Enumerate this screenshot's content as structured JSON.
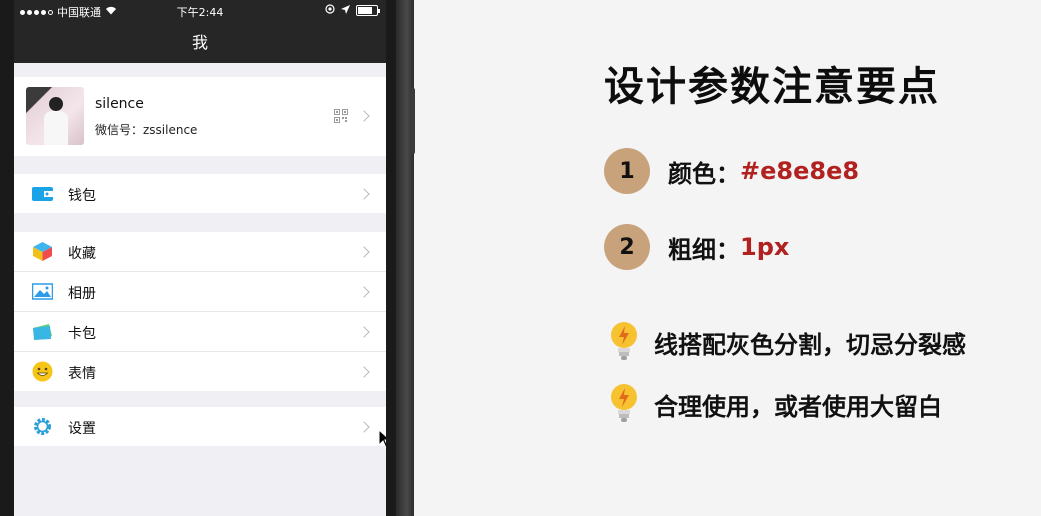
{
  "statusbar": {
    "carrier": "中国联通",
    "time": "下午2:44"
  },
  "navbar": {
    "title": "我"
  },
  "profile": {
    "name": "silence",
    "wechat_id": "微信号：zssilence"
  },
  "menu": {
    "wallet": "钱包",
    "favorites": "收藏",
    "album": "相册",
    "cards": "卡包",
    "stickers": "表情",
    "settings": "设置"
  },
  "slide": {
    "title": "设计参数注意要点",
    "points": [
      {
        "num": "1",
        "label": "颜色：",
        "value": "#e8e8e8"
      },
      {
        "num": "2",
        "label": "粗细：",
        "value": "1px"
      }
    ],
    "tips": [
      "线搭配灰色分割，切忌分裂感",
      "合理使用，或者使用大留白"
    ]
  },
  "colors": {
    "divider": "#e8e8e8",
    "accent": "#b1211f",
    "badge": "#c8a27a",
    "navbar": "#262626"
  }
}
